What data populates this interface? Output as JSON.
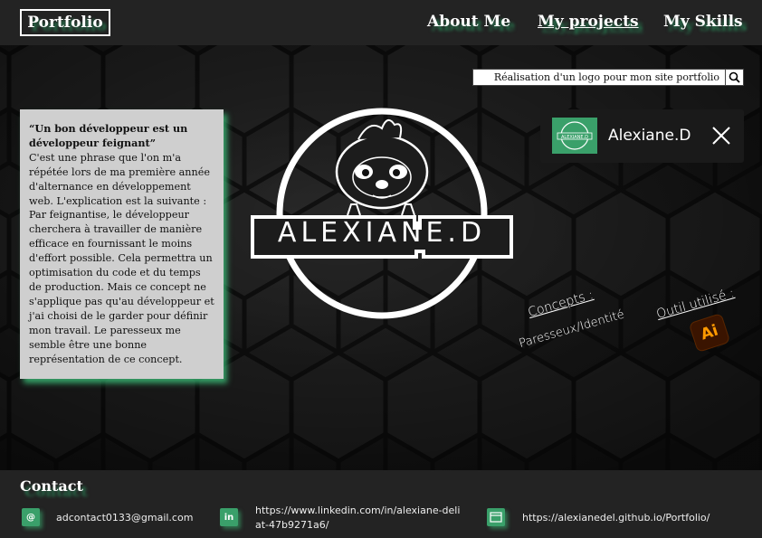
{
  "header": {
    "brand": "Portfolio",
    "nav": [
      "About Me",
      "My projects",
      "My Skills"
    ]
  },
  "search": {
    "value": "Réalisation d'un logo pour mon site portfolio",
    "icon": "search-icon"
  },
  "quote": {
    "title": "“Un bon développeur est un développeur feignant”",
    "body": "C'est une phrase que l'on m'a répétée lors de ma première année d'alternance en développement web. L'explication est la suivante : Par feignantise, le développeur cherchera à travailler de manière efficace en fournissant le moins d'effort possible. Cela permettra un optimisation du code et du temps de production. Mais ce concept ne s'applique pas qu'au développeur et j'ai choisi de le garder pour définir mon travail. Le paresseux me semble être une bonne représentation de ce concept."
  },
  "user_card": {
    "name": "Alexiane.D",
    "thumb_text": "ALEXIANE.D",
    "close_icon": "close-icon"
  },
  "logo": {
    "text": "ALEXIANE.D"
  },
  "project": {
    "concepts_label": "Concepts :",
    "concepts_value": "Paresseux/Identité",
    "tool_label": "Outil utilisé :",
    "tool_icon": "Ai"
  },
  "footer": {
    "title": "Contact",
    "email_icon": "@",
    "email": "adcontact0133@gmail.com",
    "linkedin_icon": "in",
    "linkedin": "https://www.linkedin.com/in/alexiane-deliat-47b9271a6/",
    "site": "https://alexianedel.github.io/Portfolio/"
  },
  "colors": {
    "accent": "#3aa06a",
    "background": "#1e1e1e",
    "card": "#cfcfcf"
  }
}
